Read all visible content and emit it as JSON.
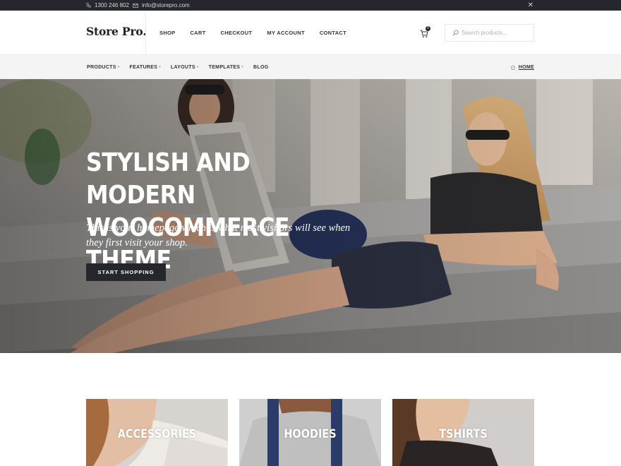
{
  "topbar": {
    "phone": "1300 246 802",
    "email": "info@storepro.com",
    "close_icon": "close-icon"
  },
  "header": {
    "logo": "Store Pro.",
    "nav": [
      "SHOP",
      "CART",
      "CHECKOUT",
      "MY ACCOUNT",
      "CONTACT"
    ],
    "cart_count": "0",
    "search_placeholder": "Search products..."
  },
  "subnav": {
    "items": [
      "PRODUCTS",
      "FEATURES",
      "LAYOUTS",
      "TEMPLATES",
      "BLOG"
    ],
    "breadcrumb": "HOME"
  },
  "hero": {
    "title_line1": "STYLISH AND MODERN",
    "title_line2": "WOOCOMMERCE THEME",
    "lead": "This is your homepage which is what most visitors will see when they first visit your shop.",
    "cta": "START SHOPPING"
  },
  "categories": [
    "ACCESSORIES",
    "HOODIES",
    "TSHIRTS"
  ],
  "colors": {
    "topbar": "#25272c",
    "subnav": "#f4f4f4",
    "button": "#25272c"
  }
}
